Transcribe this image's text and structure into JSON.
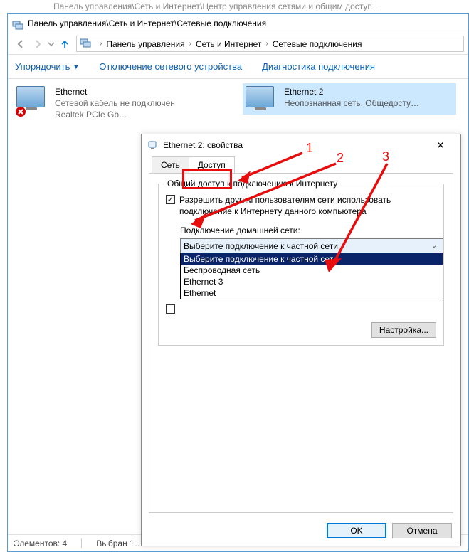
{
  "bg_window": {
    "title": "Панель управления\\Сеть и Интернет\\Центр управления сетями и общим доступ…"
  },
  "window": {
    "title": "Панель управления\\Сеть и Интернет\\Сетевые подключения",
    "breadcrumb": [
      "Панель управления",
      "Сеть и Интернет",
      "Сетевые подключения"
    ],
    "cmd": {
      "organize": "Упорядочить",
      "disable": "Отключение сетевого устройства",
      "diagnose": "Диагностика подключения"
    },
    "items": [
      {
        "name": "Ethernet",
        "line2": "Сетевой кабель не подключен",
        "line3": "Realtek PCIe Gb…",
        "disconnected": true
      },
      {
        "name": "Ethernet 2",
        "line2": "Неопознанная сеть, Общедосту…",
        "line3": "",
        "selected": true
      }
    ],
    "status": {
      "count_label": "Элементов: 4",
      "sel_label": "Выбран 1…"
    }
  },
  "dialog": {
    "title": "Ethernet 2: свойства",
    "close": "✕",
    "tabs": {
      "net": "Сеть",
      "share": "Доступ"
    },
    "group_legend": "Общий доступ к подключению к Интернету",
    "chk1_label": "Разрешить другим пользователям сети использовать подключение к Интернету данного компьютера",
    "home_net_label": "Подключение домашней сети:",
    "combo_selected": "Выберите подключение к частной сети",
    "combo_options": [
      "Выберите подключение к частной сети",
      "Беспроводная сеть",
      "Ethernet 3",
      "Ethernet"
    ],
    "chk2_label": "",
    "settings_btn": "Настройка...",
    "ok": "OK",
    "cancel": "Отмена"
  },
  "annotations": {
    "n1": "1",
    "n2": "2",
    "n3": "3"
  }
}
